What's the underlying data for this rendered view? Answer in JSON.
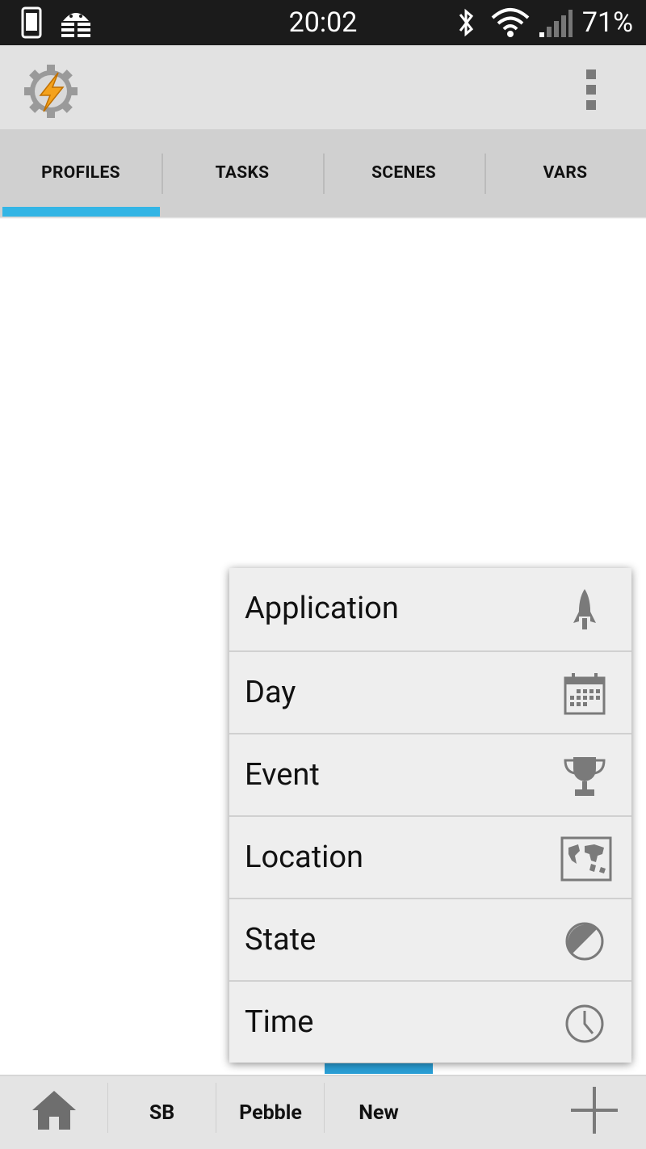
{
  "status_bar": {
    "time": "20:02",
    "battery": "71%",
    "icons": [
      "phone-icon",
      "android-debug-icon",
      "bluetooth-icon",
      "wifi-icon",
      "signal-icon"
    ]
  },
  "tabs": [
    {
      "label": "PROFILES",
      "active": true
    },
    {
      "label": "TASKS",
      "active": false
    },
    {
      "label": "SCENES",
      "active": false
    },
    {
      "label": "VARS",
      "active": false
    }
  ],
  "popup_menu": {
    "items": [
      {
        "label": "Application",
        "icon": "rocket-icon"
      },
      {
        "label": "Day",
        "icon": "calendar-icon"
      },
      {
        "label": "Event",
        "icon": "trophy-icon"
      },
      {
        "label": "Location",
        "icon": "map-icon"
      },
      {
        "label": "State",
        "icon": "contrast-icon"
      },
      {
        "label": "Time",
        "icon": "clock-icon"
      }
    ]
  },
  "bottom_bar": {
    "items": [
      {
        "label": "SB"
      },
      {
        "label": "Pebble"
      },
      {
        "label": "New",
        "active": true
      }
    ],
    "home_icon": "home-icon",
    "add_icon": "plus-icon"
  },
  "colors": {
    "accent": "#33b5e5",
    "status_bar": "#1b1b1b",
    "tab_bar": "#d0d0d0",
    "action_bar": "#e2e2e2"
  }
}
